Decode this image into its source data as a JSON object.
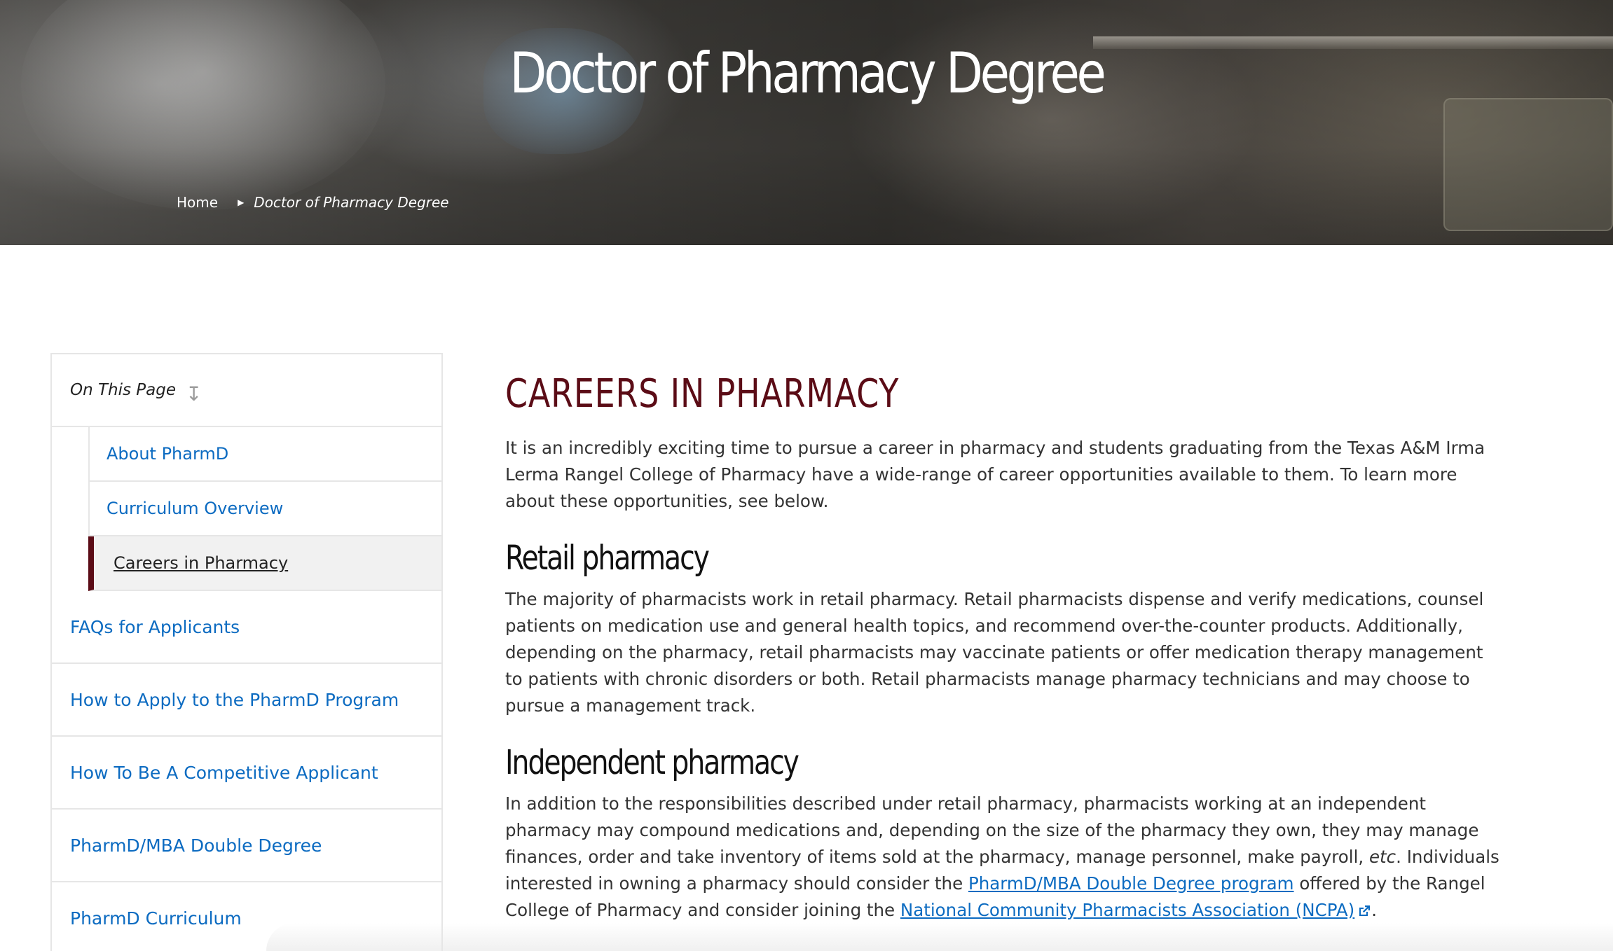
{
  "hero": {
    "title": "Doctor of Pharmacy Degree",
    "breadcrumb": {
      "home": "Home",
      "separator_icon": "caret-right-icon",
      "current": "Doctor of Pharmacy Degree"
    }
  },
  "sidebar": {
    "header": "On This Page",
    "header_icon": "arrow-down-icon",
    "sub_items": [
      {
        "label": "About PharmD"
      },
      {
        "label": "Curriculum Overview"
      },
      {
        "label": "Careers in Pharmacy"
      }
    ],
    "main_items": [
      {
        "label": "FAQs for Applicants"
      },
      {
        "label": "How to Apply to the PharmD Program"
      },
      {
        "label": "How To Be A Competitive Applicant"
      },
      {
        "label": "PharmD/MBA Double Degree"
      },
      {
        "label": "PharmD Curriculum"
      }
    ]
  },
  "content": {
    "heading": "CAREERS IN PHARMACY",
    "intro": "It is an incredibly exciting time to pursue a career in pharmacy and students graduating from the Texas A&M Irma Lerma Rangel College of Pharmacy have a wide-range of career opportunities available to them. To learn more about these opportunities, see below.",
    "sections": [
      {
        "title": "Retail pharmacy",
        "body": "The majority of pharmacists work in retail pharmacy. Retail pharmacists dispense and verify medications, counsel patients on medication use and general health topics, and recommend over-the-counter products. Additionally, depending on the pharmacy, retail pharmacists may vaccinate patients or offer medication therapy management to patients with chronic disorders or both. Retail pharmacists manage pharmacy technicians and may choose to pursue a management track."
      },
      {
        "title": "Independent pharmacy",
        "body_part1": "In addition to the responsibilities described under retail pharmacy, pharmacists working at an independent pharmacy may compound medications and, depending on the size of the pharmacy they own, they may manage finances, order and take inventory of items sold at the pharmacy, manage personnel, make payroll, ",
        "body_etc": "etc",
        "body_part2": ". Individuals interested in owning a pharmacy should consider the ",
        "link1": "PharmD/MBA Double Degree program",
        "body_part3": " offered by the Rangel College of Pharmacy and consider joining the ",
        "link2": "National Community Pharmacists Association (NCPA)",
        "link2_icon": "external-link-icon",
        "body_end": "."
      }
    ]
  },
  "colors": {
    "maroon": "#5b0c16",
    "link": "#0c6bc1",
    "text": "#333333"
  }
}
